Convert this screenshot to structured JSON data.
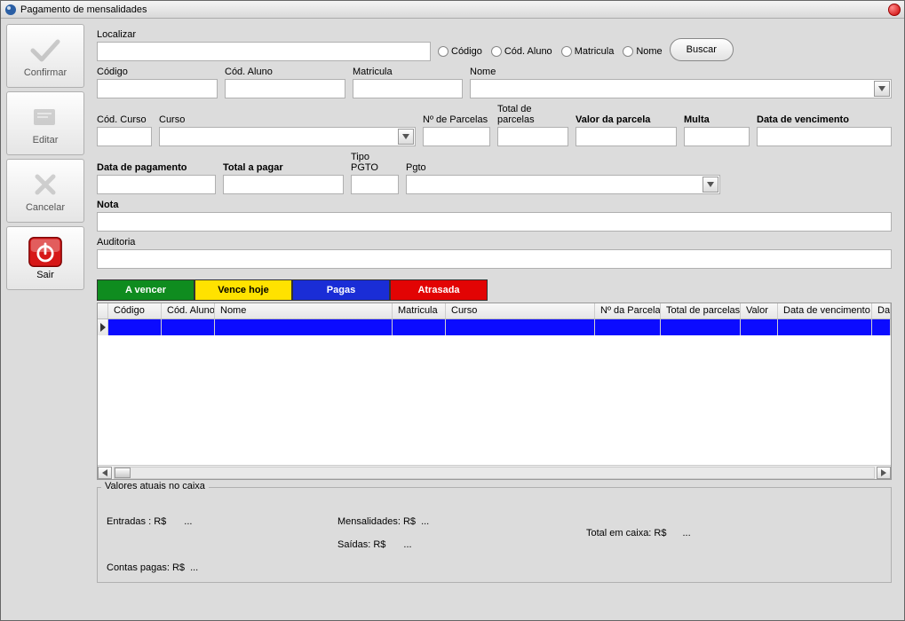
{
  "title": "Pagamento de mensalidades",
  "sidebar": {
    "confirm": "Confirmar",
    "edit": "Editar",
    "cancel": "Cancelar",
    "exit": "Sair"
  },
  "search": {
    "label": "Localizar",
    "value": "",
    "radios": {
      "codigo": "Código",
      "cod_aluno": "Cód. Aluno",
      "matricula": "Matricula",
      "nome": "Nome"
    },
    "button": "Buscar"
  },
  "fields": {
    "codigo_label": "Código",
    "codigo": "",
    "cod_aluno_label": "Cód. Aluno",
    "cod_aluno": "",
    "matricula_label": "Matricula",
    "matricula": "",
    "nome_label": "Nome",
    "nome": "",
    "cod_curso_label": "Cód. Curso",
    "cod_curso": "",
    "curso_label": "Curso",
    "curso": "",
    "n_parcelas_label": "Nº de Parcelas",
    "n_parcelas": "",
    "total_parcelas_label": "Total de parcelas",
    "total_parcelas": "",
    "valor_parcela_label": "Valor da parcela",
    "valor_parcela": "",
    "multa_label": "Multa",
    "multa": "",
    "data_venc_label": "Data de vencimento",
    "data_venc": "",
    "data_pag_label": "Data de pagamento",
    "data_pag": "",
    "total_pagar_label": "Total a pagar",
    "total_pagar": "",
    "tipo_pgto_label": "Tipo PGTO",
    "tipo_pgto": "",
    "pgto_label": "Pgto",
    "pgto": "",
    "nota_label": "Nota",
    "nota": "",
    "auditoria_label": "Auditoria",
    "auditoria": ""
  },
  "status_buttons": {
    "a_vencer": "A vencer",
    "vence_hoje": "Vence hoje",
    "pagas": "Pagas",
    "atrasada": "Atrasada"
  },
  "table": {
    "columns": [
      "Código",
      "Cód. Aluno",
      "Nome",
      "Matricula",
      "Curso",
      "Nº da Parcela",
      "Total de parcelas",
      "Valor",
      "Data de vencimento",
      "Da"
    ]
  },
  "bottom": {
    "group_title": "Valores atuais no caixa",
    "entradas_label": "Entradas : R$",
    "entradas_value": "...",
    "saidas_label": "Saídas: R$",
    "saidas_value": "...",
    "mensalidades_label": "Mensalidades:  R$",
    "mensalidades_value": "...",
    "contas_pagas_label": "Contas pagas: R$",
    "contas_pagas_value": "...",
    "total_caixa_label": "Total em caixa: R$",
    "total_caixa_value": "..."
  }
}
